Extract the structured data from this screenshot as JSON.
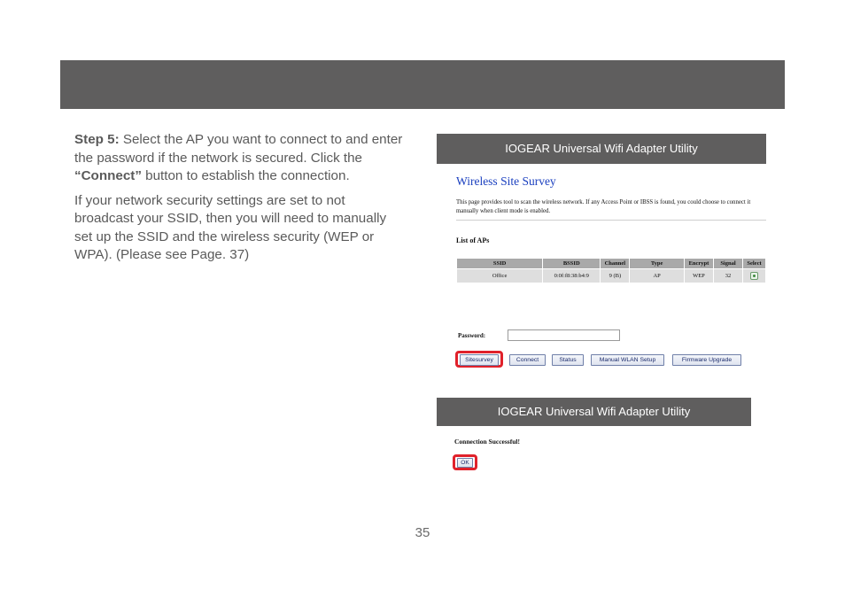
{
  "instructions": {
    "step_label": "Step 5:",
    "step_text_1": " Select the AP you want to connect to and enter the password if the network is secured. Click the ",
    "connect_quote": "“Connect”",
    "step_text_2": " button to establish the connection.",
    "para2": "If your network security settings are set to not broadcast your SSID, then you will need to manually set up the SSID and the wireless security (WEP or WPA). (Please see Page. 37)"
  },
  "app1": {
    "title": "IOGEAR Universal Wifi Adapter Utility",
    "survey_title": "Wireless Site Survey",
    "survey_desc": "This page provides tool to scan the wireless network. If any Access Point or IBSS is found, you could choose to connect it manually when client mode is enabled.",
    "list_heading": "List of APs",
    "table": {
      "headers": [
        "SSID",
        "BSSID",
        "Channel",
        "Type",
        "Encrypt",
        "Signal",
        "Select"
      ],
      "row": [
        "Office",
        "0:0f:f8:38:b4:9",
        "9 (B)",
        "AP",
        "WEP",
        "32"
      ]
    },
    "password_label": "Password:",
    "password_value": "",
    "buttons": {
      "site_survey": "Sitesurvey",
      "connect": "Connect",
      "status": "Status",
      "manual": "Manual WLAN Setup",
      "firmware": "Firmware Upgrade"
    }
  },
  "app2": {
    "title": "IOGEAR Universal Wifi Adapter Utility",
    "message": "Connection Successful!",
    "ok": "OK"
  },
  "highlight_color": "#e0212b",
  "bar_color": "#5f5e5e",
  "page_number": "35"
}
